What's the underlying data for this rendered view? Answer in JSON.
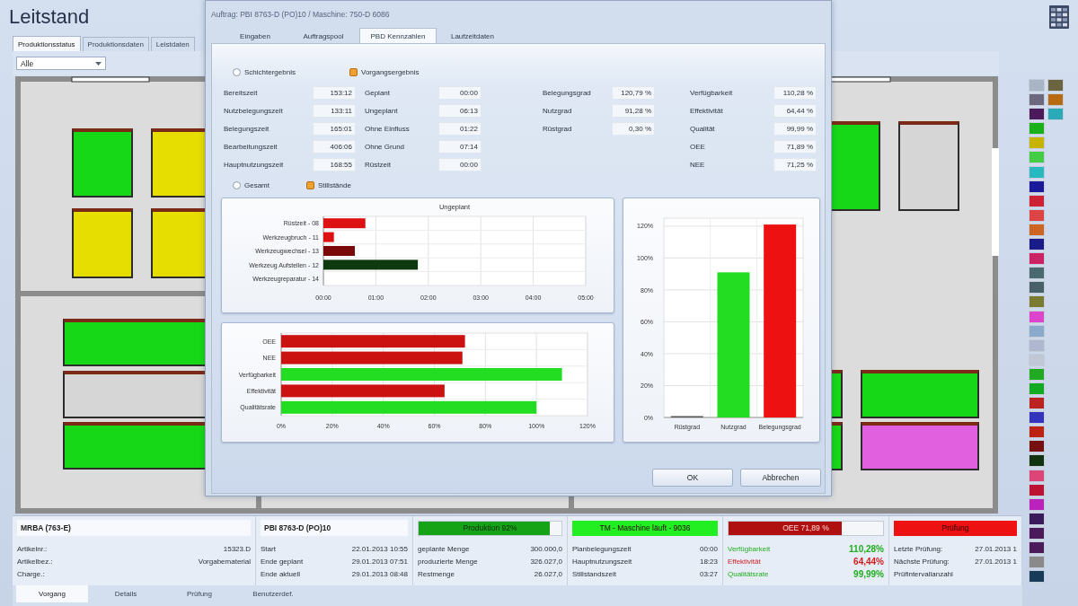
{
  "app": {
    "title": "Leitstand"
  },
  "tabs": [
    {
      "label": "Produktionsstatus",
      "selected": true
    },
    {
      "label": "Produktionsdaten",
      "selected": false
    },
    {
      "label": "Leistdaten",
      "selected": false
    }
  ],
  "filter": {
    "value": "Alle"
  },
  "floor_plan": {
    "machines": [
      {
        "color": "#16d816"
      },
      {
        "color": "#e6de00"
      },
      {
        "color": "#e6de00"
      },
      {
        "color": "#e6de00"
      },
      {
        "color": "#16d816"
      },
      {
        "color": "#d6d6d6"
      },
      {
        "color": "#16d816"
      },
      {
        "color": "#16d816"
      },
      {
        "color": "#d6d6d6"
      },
      {
        "color": "#16d816"
      },
      {
        "color": "#16d816"
      },
      {
        "color": "#16d816"
      },
      {
        "color": "#e060e0"
      }
    ]
  },
  "machine_tags": [
    {
      "color": "#a9b4c4"
    },
    {
      "color": "#6b6440"
    },
    {
      "color": "#6b6880"
    },
    {
      "color": "#b86a10"
    },
    {
      "color": "#4a1a5a"
    },
    {
      "color": "#2aaab8"
    },
    {
      "color": "#19b019"
    },
    {
      "color": "#c8b400"
    },
    {
      "color": "#44cc44"
    },
    {
      "color": "#2ab8c0"
    },
    {
      "color": "#1a1a9a"
    },
    {
      "color": "#cc2233"
    },
    {
      "color": "#dd4444"
    },
    {
      "color": "#cc6622"
    },
    {
      "color": "#1a1a8a"
    },
    {
      "color": "#cc2266"
    },
    {
      "color": "#4a6a70"
    },
    {
      "color": "#4a6068"
    },
    {
      "color": "#7a7a30"
    },
    {
      "color": "#dd44cc"
    },
    {
      "color": "#8aaacc"
    },
    {
      "color": "#b0b8d0"
    },
    {
      "color": "#c0c8d8"
    },
    {
      "color": "#22aa22"
    },
    {
      "color": "#11aa22"
    },
    {
      "color": "#bb2222"
    },
    {
      "color": "#3333bb"
    },
    {
      "color": "#bb2211"
    },
    {
      "color": "#771111"
    },
    {
      "color": "#113311"
    },
    {
      "color": "#dd4477"
    },
    {
      "color": "#bb1133"
    },
    {
      "color": "#bb22bb"
    },
    {
      "color": "#3a1a5a"
    },
    {
      "color": "#4a1a5a"
    },
    {
      "color": "#4a1a5a"
    },
    {
      "color": "#8a8a8a"
    },
    {
      "color": "#1a3a5a"
    }
  ],
  "detail_panel": {
    "sections": [
      {
        "kind": "info",
        "title": "MRBA (763-E)",
        "rows": [
          {
            "label": "Artikelnr.:",
            "value": "15323.D"
          },
          {
            "label": "Artikelbez.:",
            "value": "Vorgabematerial"
          },
          {
            "label": "Charge.:"
          }
        ]
      },
      {
        "kind": "info",
        "title": "PBI 8763-D (PO)10",
        "rows": [
          {
            "label": "Start",
            "value": "22.01.2013  10:55"
          },
          {
            "label": "Ende geplant",
            "value": "29.01.2013  07:51"
          },
          {
            "label": "Ende aktuell",
            "value": "29.01.2013  08:48"
          }
        ]
      },
      {
        "kind": "progress",
        "caption": "Produktion 92%",
        "level": 0.92,
        "color": "#17a317",
        "rows": [
          {
            "label": "geplante Menge",
            "value": "300.000,0"
          },
          {
            "label": "produzierte Menge",
            "value": "326.027,0"
          },
          {
            "label": "Restmenge",
            "value": "26.027,0"
          }
        ]
      },
      {
        "kind": "status",
        "caption": "TM - Maschine läuft - 9036",
        "color": "#22ee22",
        "rows": [
          {
            "label": "Planbelegungszeit",
            "value": "00:00"
          },
          {
            "label": "Hauptnutzungszeit",
            "value": "18:23"
          },
          {
            "label": "Stillstandszeit",
            "value": "03:27"
          }
        ]
      },
      {
        "kind": "progress",
        "caption": "OEE 71,89 %",
        "level": 0.73,
        "color": "#b01010",
        "rows": [
          {
            "label": "Verfügbarkeit",
            "value": "110,28%",
            "color": "#1fae1f"
          },
          {
            "label": "Effektivität",
            "value": "64,44%",
            "color": "#d02020"
          },
          {
            "label": "Qualitätsrate",
            "value": "99,99%",
            "color": "#1fae1f"
          }
        ]
      },
      {
        "kind": "status",
        "caption": "Prüfung",
        "color": "#ee1111",
        "rows": [
          {
            "label": "Letzte Prüfung:",
            "value": "27.01.2013 1"
          },
          {
            "label": "Nächste Prüfung:",
            "value": "27.01.2013 1"
          },
          {
            "label": "Prüfintervallanzahl"
          }
        ]
      }
    ]
  },
  "bottom_tabs": [
    {
      "label": "Vorgang",
      "selected": true
    },
    {
      "label": "Details",
      "selected": false
    },
    {
      "label": "Prüfung",
      "selected": false
    },
    {
      "label": "Benutzerdef.",
      "selected": false
    }
  ],
  "dialog": {
    "title": "Auftrag: PBI 8763-D (PO)10 / Maschine: 750-D 6086",
    "tabs": [
      {
        "label": "Eingaben",
        "selected": false
      },
      {
        "label": "Auftragspool",
        "selected": false
      },
      {
        "label": "PBD Kennzahlen",
        "selected": true
      },
      {
        "label": "Laufzeitdaten",
        "selected": false
      }
    ],
    "result_mode": [
      {
        "label": "Schichtergebnis",
        "selected": false
      },
      {
        "label": "Vorgangsergebnis",
        "selected": true
      }
    ],
    "field_columns": [
      [
        {
          "label": "Bereitszeit",
          "value": "153:12"
        },
        {
          "label": "Nutzbelegungszeit",
          "value": "133:11"
        },
        {
          "label": "Belegungszeit",
          "value": "165:01"
        },
        {
          "label": "Bearbeitungszeit",
          "value": "406:06"
        },
        {
          "label": "Hauptnutzungszeit",
          "value": "168:55"
        }
      ],
      [
        {
          "label": "Geplant",
          "value": "00:00"
        },
        {
          "label": "Ungeplant",
          "value": "06:13"
        },
        {
          "label": "Ohne Einfluss",
          "value": "01:22"
        },
        {
          "label": "Ohne Grund",
          "value": "07:14"
        },
        {
          "label": "Rüstzeit",
          "value": "00:00"
        }
      ],
      [
        {
          "label": "Belegungsgrad",
          "value": "120,79 %"
        },
        {
          "label": "Nutzgrad",
          "value": "91,28 %"
        },
        {
          "label": "Rüstgrad",
          "value": "0,30 %"
        }
      ],
      [
        {
          "label": "Verfügbarkeit",
          "value": "110,28 %"
        },
        {
          "label": "Effektivität",
          "value": "64,44 %"
        },
        {
          "label": "Qualität",
          "value": "99,99 %"
        },
        {
          "label": "OEE",
          "value": "71,89 %"
        },
        {
          "label": "NEE",
          "value": "71,25 %"
        }
      ]
    ],
    "view_mode": [
      {
        "label": "Gesamt",
        "selected": false
      },
      {
        "label": "Stillstände",
        "selected": true
      }
    ],
    "charts": [
      {
        "chart_data": {
          "type": "bar",
          "orientation": "horizontal",
          "title": "Ungeplant",
          "categories": [
            "Rüstzeit - 08",
            "Werkzeugbruch - 11",
            "Werkzeugwechsel - 13",
            "Werkzeug Aufstellen - 12",
            "Werkzeugreparatur - 14"
          ],
          "values": [
            0.8,
            0.2,
            0.6,
            1.8,
            0
          ],
          "colors": [
            "#dd1111",
            "#dd1111",
            "#7a0a0a",
            "#0f3a0f",
            "#bbbbbb"
          ],
          "xlim": [
            0,
            5
          ],
          "xticks": [
            {
              "value": 0,
              "label": "00:00"
            },
            {
              "value": 1,
              "label": "01:00"
            },
            {
              "value": 2,
              "label": "02:00"
            },
            {
              "value": 3,
              "label": "03:00"
            },
            {
              "value": 4,
              "label": "04:00"
            },
            {
              "value": 5,
              "label": "05:00"
            }
          ],
          "grid": true
        }
      },
      {
        "chart_data": {
          "type": "bar",
          "orientation": "horizontal",
          "categories": [
            "OEE",
            "NEE",
            "Verfügbarkeit",
            "Effektivität",
            "Qualitätsrate"
          ],
          "values": [
            72,
            71,
            110,
            64,
            100
          ],
          "colors": [
            "#cc1111",
            "#cc1111",
            "#22dd22",
            "#cc1111",
            "#22dd22"
          ],
          "xlim": [
            0,
            120
          ],
          "xticks": [
            {
              "value": 0,
              "label": "0%"
            },
            {
              "value": 20,
              "label": "20%"
            },
            {
              "value": 40,
              "label": "40%"
            },
            {
              "value": 60,
              "label": "60%"
            },
            {
              "value": 80,
              "label": "80%"
            },
            {
              "value": 100,
              "label": "100%"
            },
            {
              "value": 120,
              "label": "120%"
            }
          ],
          "grid": true
        }
      },
      {
        "chart_data": {
          "type": "bar",
          "orientation": "vertical",
          "categories": [
            "Rüstgrad",
            "Nutzgrad",
            "Belegungsgrad"
          ],
          "values": [
            0,
            91,
            121
          ],
          "colors": [
            "#555555",
            "#22dd22",
            "#ee1111"
          ],
          "ylim": [
            0,
            125
          ],
          "yticks": [
            {
              "value": 0,
              "label": "0%"
            },
            {
              "value": 20,
              "label": "20%"
            },
            {
              "value": 40,
              "label": "40%"
            },
            {
              "value": 60,
              "label": "60%"
            },
            {
              "value": 80,
              "label": "80%"
            },
            {
              "value": 100,
              "label": "100%"
            },
            {
              "value": 120,
              "label": "120%"
            }
          ],
          "grid": true
        }
      }
    ],
    "buttons": [
      {
        "label": "OK"
      },
      {
        "label": "Abbrechen"
      }
    ]
  }
}
